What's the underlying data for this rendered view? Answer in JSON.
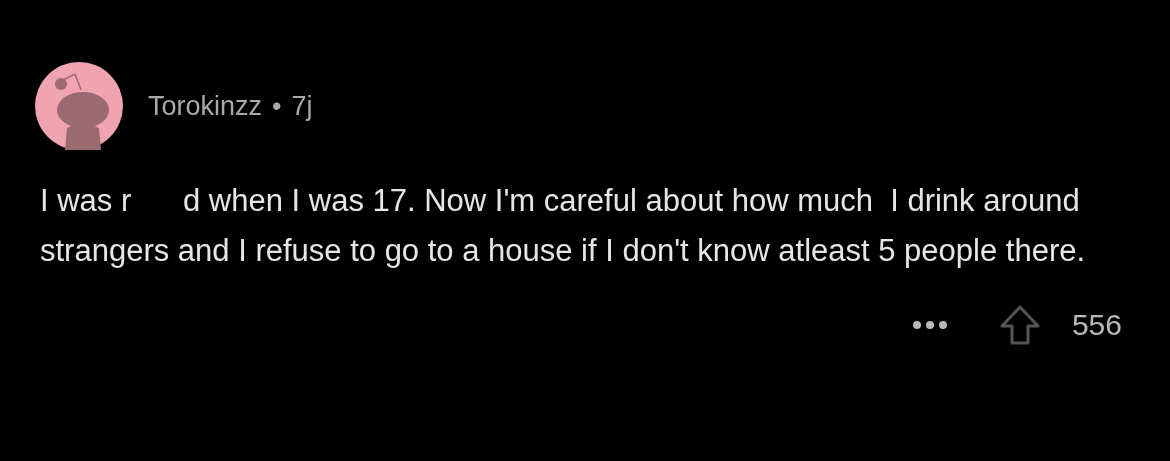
{
  "comment": {
    "author": "Torokinzz",
    "separator": "•",
    "age": "7j",
    "body": "I was r      d when I was 17. Now I'm careful about how much  I drink around strangers and I refuse to go to a house if I don't know atleast 5 people there.",
    "score": "556"
  }
}
